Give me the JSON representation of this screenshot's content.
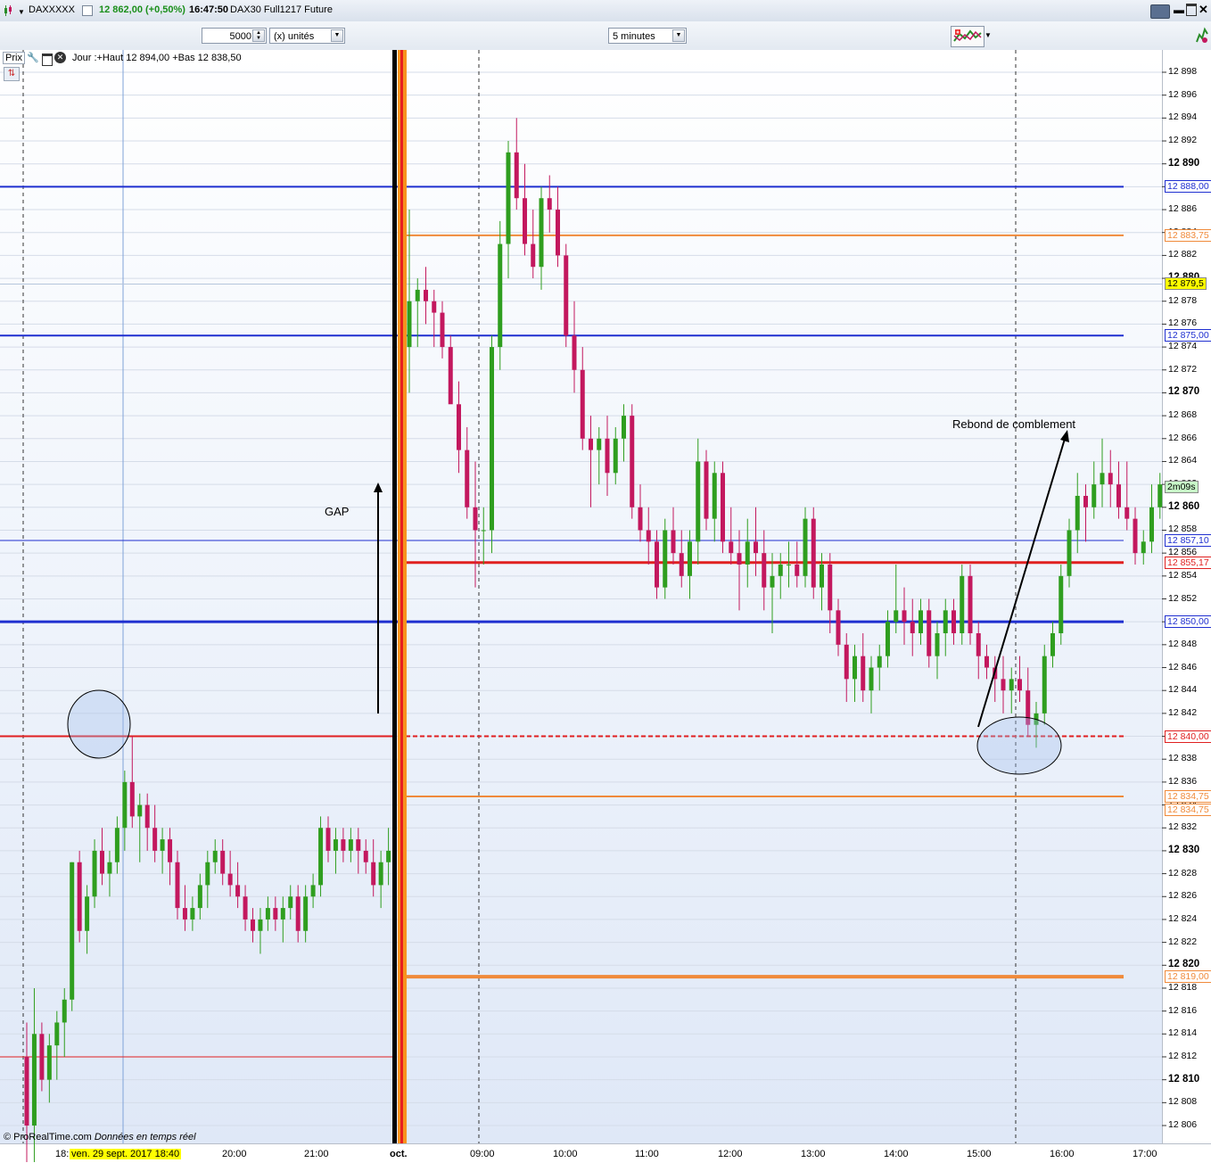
{
  "window": {
    "symbol": "DAXXXXX",
    "price": "12 862,00 (+0,50%)",
    "time": "16:47:50",
    "instrument": "DAX30 Full1217 Future"
  },
  "toolbar": {
    "quantity": "5000",
    "units": "(x) unités",
    "timeframe": "5 minutes"
  },
  "legend": {
    "label": "Prix",
    "info": "Jour :+Haut 12 894,00 +Bas 12 838,50"
  },
  "annotations": {
    "gap": "GAP",
    "rebound": "Rebond de comblement",
    "copyright": "© ProRealTime.com",
    "realtime": "Données en temps réel"
  },
  "price_axis": {
    "ticks": [
      "12 898",
      "12 896",
      "12 894",
      "12 892",
      "12 890",
      "12 888",
      "12 886",
      "12 884",
      "12 882",
      "12 880",
      "12 878",
      "12 876",
      "12 874",
      "12 872",
      "12 870",
      "12 868",
      "12 866",
      "12 864",
      "12 862",
      "12 860",
      "12 858",
      "12 856",
      "12 854",
      "12 852",
      "12 850",
      "12 848",
      "12 846",
      "12 844",
      "12 842",
      "12 840",
      "12 838",
      "12 836",
      "12 834",
      "12 832",
      "12 830",
      "12 828",
      "12 826",
      "12 824",
      "12 822",
      "12 820",
      "12 818",
      "12 816",
      "12 814",
      "12 812",
      "12 810",
      "12 808",
      "12 806"
    ],
    "level_labels": [
      {
        "text": "12 888,00",
        "color": "#1f2fd0"
      },
      {
        "text": "12 883,75",
        "color": "#f08a3a"
      },
      {
        "text": "12 879,5",
        "color": "#000000",
        "bg": "#ffff00"
      },
      {
        "text": "12 875,00",
        "color": "#1f2fd0"
      },
      {
        "text": "2m09s",
        "color": "#000000",
        "bg": "#c8f7c8"
      },
      {
        "text": "12 857,10",
        "color": "#1f2fd0"
      },
      {
        "text": "12 855,17",
        "color": "#e02020"
      },
      {
        "text": "12 850,00",
        "color": "#1f2fd0"
      },
      {
        "text": "12 840,00",
        "color": "#e02020"
      },
      {
        "text": "12 834,75",
        "color": "#f08a3a"
      },
      {
        "text": "12 834,75",
        "color": "#f08a3a"
      },
      {
        "text": "12 819,00",
        "color": "#f08a3a"
      }
    ]
  },
  "time_axis": {
    "labels": [
      "18:",
      "ven. 29 sept. 2017 18:40",
      "20:00",
      "21:00",
      "oct.",
      "09:00",
      "10:00",
      "11:00",
      "12:00",
      "13:00",
      "14:00",
      "15:00",
      "16:00",
      "17:00"
    ]
  },
  "chart_data": {
    "type": "candlestick",
    "timeframe": "5 minutes",
    "ylim": [
      12805,
      12900
    ],
    "horizontal_levels": [
      {
        "value": 12888.0,
        "color": "#1f2fd0"
      },
      {
        "value": 12883.75,
        "color": "#f08a3a"
      },
      {
        "value": 12875.0,
        "color": "#1f2fd0"
      },
      {
        "value": 12857.1,
        "color": "#1f2fd0"
      },
      {
        "value": 12855.17,
        "color": "#e02020"
      },
      {
        "value": 12850.0,
        "color": "#1f2fd0"
      },
      {
        "value": 12840.0,
        "color": "#e02020"
      },
      {
        "value": 12834.75,
        "color": "#f08a3a"
      },
      {
        "value": 12819.0,
        "color": "#f08a3a"
      },
      {
        "value": 12812.0,
        "color": "#e02020"
      }
    ],
    "candles": [
      [
        12812,
        12815,
        12800,
        12806
      ],
      [
        12806,
        12818,
        12802,
        12814
      ],
      [
        12814,
        12815,
        12809,
        12810
      ],
      [
        12810,
        12814,
        12808,
        12813
      ],
      [
        12813,
        12816,
        12810,
        12815
      ],
      [
        12815,
        12818,
        12812,
        12817
      ],
      [
        12817,
        12829,
        12816,
        12829
      ],
      [
        12829,
        12830,
        12822,
        12823
      ],
      [
        12823,
        12827,
        12821,
        12826
      ],
      [
        12826,
        12831,
        12825,
        12830
      ],
      [
        12830,
        12832,
        12827,
        12828
      ],
      [
        12828,
        12830,
        12826,
        12829
      ],
      [
        12829,
        12833,
        12828,
        12832
      ],
      [
        12832,
        12837,
        12830,
        12836
      ],
      [
        12836,
        12840,
        12832,
        12833
      ],
      [
        12833,
        12835,
        12829,
        12834
      ],
      [
        12834,
        12835,
        12830,
        12832
      ],
      [
        12832,
        12834,
        12829,
        12830
      ],
      [
        12830,
        12832,
        12828,
        12831
      ],
      [
        12831,
        12832,
        12827,
        12829
      ],
      [
        12829,
        12830,
        12824,
        12825
      ],
      [
        12825,
        12827,
        12823,
        12824
      ],
      [
        12824,
        12826,
        12823,
        12825
      ],
      [
        12825,
        12828,
        12824,
        12827
      ],
      [
        12827,
        12830,
        12825,
        12829
      ],
      [
        12829,
        12831,
        12828,
        12830
      ],
      [
        12830,
        12831,
        12827,
        12828
      ],
      [
        12828,
        12830,
        12826,
        12827
      ],
      [
        12827,
        12829,
        12825,
        12826
      ],
      [
        12826,
        12827,
        12823,
        12824
      ],
      [
        12824,
        12825,
        12822,
        12823
      ],
      [
        12823,
        12825,
        12821,
        12824
      ],
      [
        12824,
        12826,
        12823,
        12825
      ],
      [
        12825,
        12826,
        12823,
        12824
      ],
      [
        12824,
        12826,
        12822,
        12825
      ],
      [
        12825,
        12827,
        12824,
        12826
      ],
      [
        12826,
        12827,
        12822,
        12823
      ],
      [
        12823,
        12827,
        12822,
        12826
      ],
      [
        12826,
        12828,
        12825,
        12827
      ],
      [
        12827,
        12833,
        12826,
        12832
      ],
      [
        12832,
        12833,
        12829,
        12830
      ],
      [
        12830,
        12832,
        12828,
        12831
      ],
      [
        12831,
        12832,
        12829,
        12830
      ],
      [
        12830,
        12832,
        12829,
        12831
      ],
      [
        12831,
        12832,
        12828,
        12830
      ],
      [
        12830,
        12831,
        12828,
        12829
      ],
      [
        12829,
        12831,
        12826,
        12827
      ],
      [
        12827,
        12830,
        12825,
        12829
      ],
      [
        12829,
        12832,
        12827,
        12830
      ],
      [
        12874,
        12886,
        12870,
        12878
      ],
      [
        12878,
        12880,
        12874,
        12879
      ],
      [
        12879,
        12881,
        12876,
        12878
      ],
      [
        12878,
        12879,
        12874,
        12877
      ],
      [
        12877,
        12878,
        12873,
        12874
      ],
      [
        12874,
        12875,
        12870,
        12869
      ],
      [
        12869,
        12871,
        12863,
        12865
      ],
      [
        12865,
        12867,
        12859,
        12860
      ],
      [
        12860,
        12864,
        12853,
        12858
      ],
      [
        12858,
        12860,
        12855,
        12858
      ],
      [
        12858,
        12875,
        12856,
        12874
      ],
      [
        12874,
        12885,
        12872,
        12883
      ],
      [
        12883,
        12892,
        12880,
        12891
      ],
      [
        12891,
        12894,
        12886,
        12887
      ],
      [
        12887,
        12890,
        12882,
        12883
      ],
      [
        12883,
        12886,
        12880,
        12881
      ],
      [
        12881,
        12888,
        12879,
        12887
      ],
      [
        12887,
        12889,
        12884,
        12886
      ],
      [
        12886,
        12888,
        12881,
        12882
      ],
      [
        12882,
        12883,
        12874,
        12875
      ],
      [
        12875,
        12878,
        12870,
        12872
      ],
      [
        12872,
        12874,
        12865,
        12866
      ],
      [
        12866,
        12868,
        12860,
        12865
      ],
      [
        12865,
        12867,
        12862,
        12866
      ],
      [
        12866,
        12868,
        12861,
        12863
      ],
      [
        12863,
        12867,
        12862,
        12866
      ],
      [
        12866,
        12869,
        12864,
        12868
      ],
      [
        12868,
        12869,
        12859,
        12860
      ],
      [
        12860,
        12862,
        12857,
        12858
      ],
      [
        12858,
        12860,
        12855,
        12857
      ],
      [
        12857,
        12858,
        12852,
        12853
      ],
      [
        12853,
        12859,
        12852,
        12858
      ],
      [
        12858,
        12860,
        12855,
        12856
      ],
      [
        12856,
        12858,
        12853,
        12854
      ],
      [
        12854,
        12858,
        12852,
        12857
      ],
      [
        12857,
        12866,
        12855,
        12864
      ],
      [
        12864,
        12865,
        12858,
        12859
      ],
      [
        12859,
        12864,
        12857,
        12863
      ],
      [
        12863,
        12864,
        12856,
        12857
      ],
      [
        12857,
        12860,
        12855,
        12856
      ],
      [
        12856,
        12858,
        12851,
        12855
      ],
      [
        12855,
        12859,
        12853,
        12857
      ],
      [
        12857,
        12860,
        12854,
        12856
      ],
      [
        12856,
        12858,
        12851,
        12853
      ],
      [
        12853,
        12856,
        12849,
        12854
      ],
      [
        12854,
        12856,
        12852,
        12855
      ],
      [
        12855,
        12857,
        12853,
        12855
      ],
      [
        12855,
        12857,
        12853,
        12854
      ],
      [
        12854,
        12860,
        12853,
        12859
      ],
      [
        12859,
        12860,
        12852,
        12853
      ],
      [
        12853,
        12856,
        12851,
        12855
      ],
      [
        12855,
        12856,
        12849,
        12851
      ],
      [
        12851,
        12852,
        12847,
        12848
      ],
      [
        12848,
        12849,
        12843,
        12845
      ],
      [
        12845,
        12848,
        12843,
        12847
      ],
      [
        12847,
        12849,
        12843,
        12844
      ],
      [
        12844,
        12847,
        12842,
        12846
      ],
      [
        12846,
        12848,
        12844,
        12847
      ],
      [
        12847,
        12851,
        12846,
        12850
      ],
      [
        12850,
        12855,
        12849,
        12851
      ],
      [
        12851,
        12853,
        12848,
        12850
      ],
      [
        12850,
        12852,
        12847,
        12849
      ],
      [
        12849,
        12852,
        12848,
        12851
      ],
      [
        12851,
        12852,
        12846,
        12847
      ],
      [
        12847,
        12850,
        12845,
        12849
      ],
      [
        12849,
        12852,
        12847,
        12851
      ],
      [
        12851,
        12852,
        12848,
        12849
      ],
      [
        12849,
        12855,
        12848,
        12854
      ],
      [
        12854,
        12855,
        12848,
        12849
      ],
      [
        12849,
        12850,
        12845,
        12847
      ],
      [
        12847,
        12848,
        12845,
        12846
      ],
      [
        12846,
        12847,
        12843,
        12845
      ],
      [
        12845,
        12847,
        12842,
        12844
      ],
      [
        12844,
        12846,
        12842,
        12845
      ],
      [
        12845,
        12847,
        12843,
        12844
      ],
      [
        12844,
        12846,
        12840,
        12841
      ],
      [
        12841,
        12843,
        12839,
        12842
      ],
      [
        12842,
        12848,
        12841,
        12847
      ],
      [
        12847,
        12850,
        12846,
        12849
      ],
      [
        12849,
        12855,
        12848,
        12854
      ],
      [
        12854,
        12859,
        12853,
        12858
      ],
      [
        12858,
        12863,
        12856,
        12861
      ],
      [
        12861,
        12862,
        12857,
        12860
      ],
      [
        12860,
        12864,
        12859,
        12862
      ],
      [
        12862,
        12866,
        12860,
        12863
      ],
      [
        12863,
        12865,
        12860,
        12862
      ],
      [
        12862,
        12864,
        12859,
        12860
      ],
      [
        12860,
        12864,
        12858,
        12859
      ],
      [
        12859,
        12860,
        12855,
        12856
      ],
      [
        12856,
        12858,
        12855,
        12857
      ],
      [
        12857,
        12862,
        12856,
        12860
      ],
      [
        12860,
        12863,
        12859,
        12862
      ]
    ]
  }
}
